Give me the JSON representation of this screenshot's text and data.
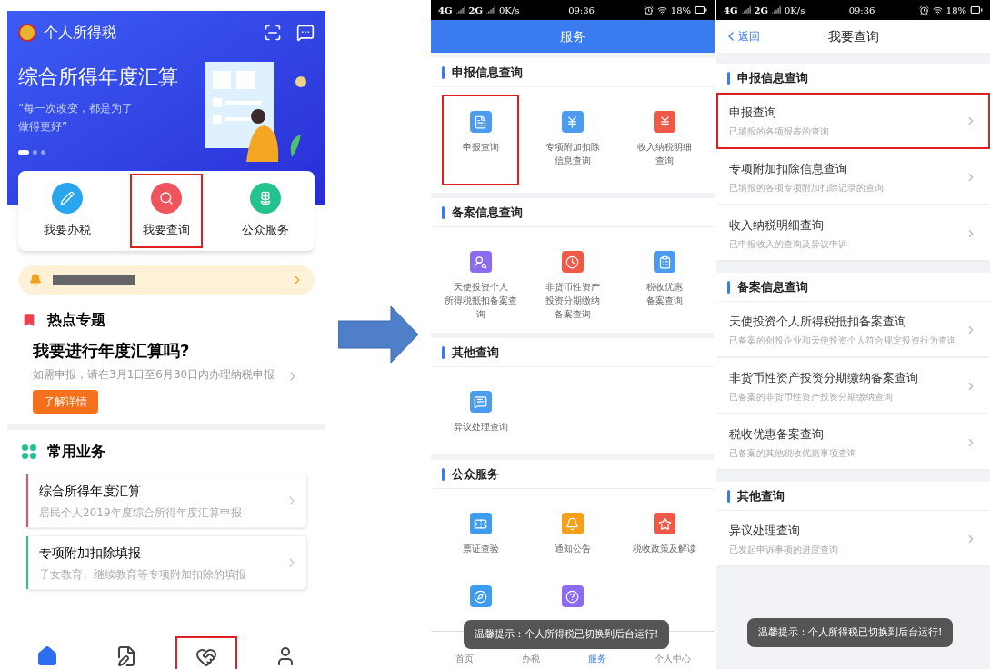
{
  "home": {
    "app_title": "个人所得税",
    "banner": {
      "title": "综合所得年度汇算",
      "quote_lines": [
        "“每一次改变，都是为了",
        "做得更好”"
      ],
      "dots": [
        {
          "selected": true
        },
        {
          "selected": false
        },
        {
          "selected": false
        }
      ]
    },
    "actions": [
      {
        "label": "我要办税",
        "kind": "pen",
        "highlighted": false
      },
      {
        "label": "我要查询",
        "kind": "search",
        "highlighted": true
      },
      {
        "label": "公众服务",
        "kind": "flower",
        "highlighted": false
      }
    ],
    "hot_topic": {
      "heading": "热点专题",
      "title": "我要进行年度汇算吗?",
      "subtitle": "如需申报，请在3月1日至6月30日内办理纳税申报",
      "button": "了解详情"
    },
    "common": {
      "heading": "常用业务",
      "items": [
        {
          "title": "综合所得年度汇算",
          "subtitle": "居民个人2019年度综合所得年度汇算申报",
          "color": "#e8506e"
        },
        {
          "title": "专项附加扣除填报",
          "subtitle": "子女教育、继续教育等专项附加扣除的填报",
          "color": "#2fc48d"
        }
      ]
    },
    "tabbar": [
      {
        "kind": "home",
        "selected": true,
        "highlighted": false
      },
      {
        "kind": "tax",
        "selected": false,
        "highlighted": false
      },
      {
        "kind": "service",
        "selected": false,
        "highlighted": true
      },
      {
        "kind": "user",
        "selected": false,
        "highlighted": false
      }
    ]
  },
  "services": {
    "status_bar": {
      "network_1": "4G",
      "network_2": "2G",
      "speed": "0K/s",
      "time": "09:36",
      "battery": "18%"
    },
    "title": "服务",
    "sections": [
      {
        "heading": "申报信息查询",
        "items": [
          {
            "label_lines": [
              "申报查询"
            ],
            "kind": "doc",
            "highlighted": true
          },
          {
            "label_lines": [
              "专项附加扣除",
              "信息查询"
            ],
            "kind": "yen-doc",
            "highlighted": false
          },
          {
            "label_lines": [
              "收入纳税明细",
              "查询"
            ],
            "kind": "yen-shield",
            "highlighted": false
          }
        ]
      },
      {
        "heading": "备案信息查询",
        "items": [
          {
            "label_lines": [
              "天使投资个人",
              "所得税抵扣备案查",
              "询"
            ],
            "kind": "person-search",
            "highlighted": false
          },
          {
            "label_lines": [
              "非货币性资产",
              "投资分期缴纳",
              "备案查询"
            ],
            "kind": "clock-search",
            "highlighted": false
          },
          {
            "label_lines": [
              "税收优惠",
              "备案查询"
            ],
            "kind": "list-search",
            "highlighted": false
          }
        ]
      },
      {
        "heading": "其他查询",
        "items": [
          {
            "label_lines": [
              "异议处理查询"
            ],
            "kind": "chat-doc",
            "highlighted": false
          }
        ]
      },
      {
        "heading": "公众服务",
        "items": [
          {
            "label_lines": [
              "票证查验"
            ],
            "kind": "ticket",
            "highlighted": false
          },
          {
            "label_lines": [
              "通知公告"
            ],
            "kind": "bell",
            "highlighted": false
          },
          {
            "label_lines": [
              "税收政策及解读"
            ],
            "kind": "star-doc",
            "highlighted": false
          },
          {
            "kind": "compass",
            "highlighted": false
          },
          {
            "kind": "question",
            "highlighted": false
          }
        ]
      }
    ],
    "tabbar": [
      {
        "label": "首页",
        "selected": false
      },
      {
        "label": "办税",
        "selected": false
      },
      {
        "label": "服务",
        "selected": true
      },
      {
        "label": "个人中心",
        "selected": false
      }
    ],
    "toast": "温馨提示：个人所得税已切换到后台运行!"
  },
  "query": {
    "status_bar": {
      "network_1": "4G",
      "network_2": "2G",
      "speed": "0K/s",
      "time": "09:36",
      "battery": "18%"
    },
    "back": "返回",
    "title": "我要查询",
    "sections": [
      {
        "heading": "申报信息查询",
        "items": [
          {
            "title": "申报查询",
            "subtitle": "已填报的各项报表的查询",
            "highlighted": true
          },
          {
            "title": "专项附加扣除信息查询",
            "subtitle": "已填报的各项专项附加扣除记录的查询",
            "highlighted": false
          },
          {
            "title": "收入纳税明细查询",
            "subtitle": "已申报收入的查询及异议申诉",
            "highlighted": false
          }
        ]
      },
      {
        "heading": "备案信息查询",
        "items": [
          {
            "title": "天使投资个人所得税抵扣备案查询",
            "subtitle": "已备案的创投企业和天使投资个人符合规定投资行为查询",
            "highlighted": false
          },
          {
            "title": "非货币性资产投资分期缴纳备案查询",
            "subtitle": "已备案的非货币性资产投资分期缴纳查询",
            "highlighted": false
          },
          {
            "title": "税收优惠备案查询",
            "subtitle": "已备案的其他税收优惠事项查询",
            "highlighted": false
          }
        ]
      },
      {
        "heading": "其他查询",
        "items": [
          {
            "title": "异议处理查询",
            "subtitle": "已发起申诉事项的进度查询",
            "highlighted": false
          }
        ]
      }
    ],
    "toast": "温馨提示：个人所得税已切换到后台运行!"
  }
}
